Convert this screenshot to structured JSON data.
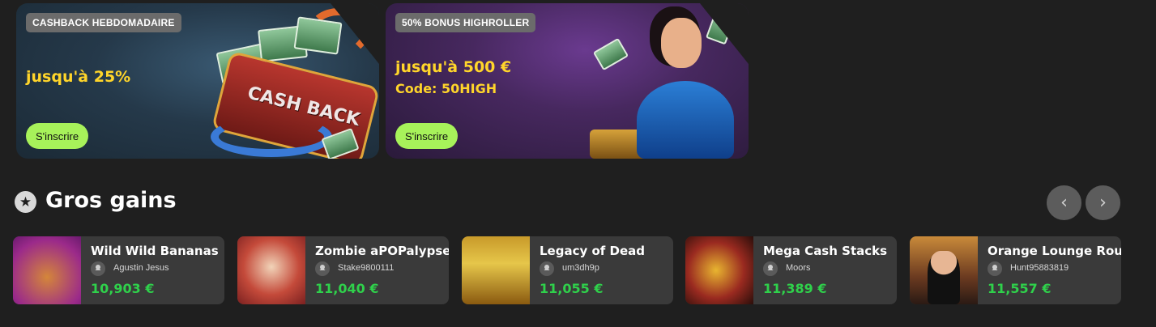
{
  "promos": [
    {
      "badge": "CASHBACK HEBDOMADAIRE",
      "title": "jusqu'à 25%",
      "code": "",
      "button": "S'inscrire",
      "art_text": "CASH BACK"
    },
    {
      "badge": "50% BONUS HIGHROLLER",
      "title": "jusqu'à 500 €",
      "code": "Code: 50HIGH",
      "button": "S'inscrire"
    }
  ],
  "section": {
    "title": "Gros gains",
    "icon": "star-icon",
    "prev_icon": "‹",
    "next_icon": "›"
  },
  "wins": [
    {
      "game": "Wild Wild Bananas",
      "user": "Agustin Jesus",
      "amount": "10,903 €"
    },
    {
      "game": "Zombie aPOPalypse",
      "user": "Stake9800111",
      "amount": "11,040 €"
    },
    {
      "game": "Legacy of Dead",
      "user": "um3dh9p",
      "amount": "11,055 €"
    },
    {
      "game": "Mega Cash Stacks",
      "user": "Moors",
      "amount": "11,389 €"
    },
    {
      "game": "Orange Lounge Roule",
      "user": "Hunt95883819",
      "amount": "11,557 €"
    }
  ],
  "colors": {
    "accent_button": "#a7f25a",
    "promo_title": "#ffd52a",
    "win_amount": "#2fd14b",
    "background": "#1f1f1f",
    "card": "#3a3a3a"
  }
}
